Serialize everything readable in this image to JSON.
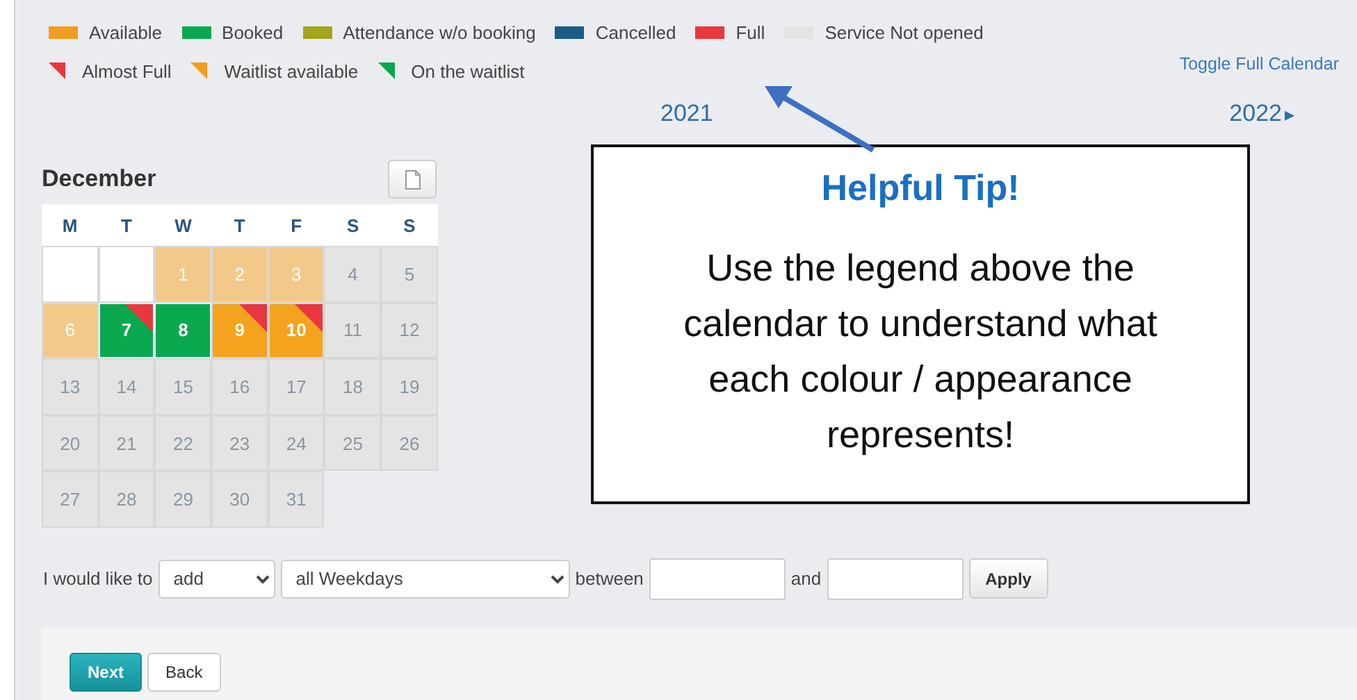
{
  "legend": [
    {
      "label": "Available",
      "kind": "bar",
      "color": "#f39c1f"
    },
    {
      "label": "Booked",
      "kind": "bar",
      "color": "#0aa84f"
    },
    {
      "label": "Attendance w/o booking",
      "kind": "bar",
      "color": "#a3a51c"
    },
    {
      "label": "Cancelled",
      "kind": "bar",
      "color": "#1c5a8a"
    },
    {
      "label": "Full",
      "kind": "bar",
      "color": "#e8373f"
    },
    {
      "label": "Service Not opened",
      "kind": "bar",
      "color": "#e4e4e4"
    },
    {
      "label": "Almost Full",
      "kind": "corner",
      "color": "#e8373f"
    },
    {
      "label": "Waitlist available",
      "kind": "corner",
      "color": "#f39c1f"
    },
    {
      "label": "On the waitlist",
      "kind": "corner",
      "color": "#0aa84f"
    }
  ],
  "toggle_link": "Toggle Full Calendar",
  "years": {
    "current": "2021",
    "next": "2022",
    "next_arrow": "▸"
  },
  "calendar": {
    "month": "December",
    "weekdays": [
      "M",
      "T",
      "W",
      "T",
      "F",
      "S",
      "S"
    ],
    "days": [
      {
        "kind": "blank"
      },
      {
        "kind": "blank"
      },
      {
        "label": "1",
        "kind": "available"
      },
      {
        "label": "2",
        "kind": "available"
      },
      {
        "label": "3",
        "kind": "available"
      },
      {
        "label": "4",
        "kind": "closed"
      },
      {
        "label": "5",
        "kind": "closed"
      },
      {
        "label": "6",
        "kind": "available"
      },
      {
        "label": "7",
        "kind": "booked",
        "color": "#e8373f"
      },
      {
        "label": "8",
        "kind": "booked"
      },
      {
        "label": "9",
        "kind": "waitlist",
        "color": "#e8373f"
      },
      {
        "label": "10",
        "kind": "waitlist",
        "color": "#e8373f"
      },
      {
        "label": "11",
        "kind": "closed"
      },
      {
        "label": "12",
        "kind": "closed"
      },
      {
        "label": "13",
        "kind": "closed"
      },
      {
        "label": "14",
        "kind": "closed"
      },
      {
        "label": "15",
        "kind": "closed"
      },
      {
        "label": "16",
        "kind": "closed"
      },
      {
        "label": "17",
        "kind": "closed"
      },
      {
        "label": "18",
        "kind": "closed"
      },
      {
        "label": "19",
        "kind": "closed"
      },
      {
        "label": "20",
        "kind": "closed"
      },
      {
        "label": "21",
        "kind": "closed"
      },
      {
        "label": "22",
        "kind": "closed"
      },
      {
        "label": "23",
        "kind": "closed"
      },
      {
        "label": "24",
        "kind": "closed"
      },
      {
        "label": "25",
        "kind": "closed"
      },
      {
        "label": "26",
        "kind": "closed"
      },
      {
        "label": "27",
        "kind": "closed"
      },
      {
        "label": "28",
        "kind": "closed"
      },
      {
        "label": "29",
        "kind": "closed"
      },
      {
        "label": "30",
        "kind": "closed"
      },
      {
        "label": "31",
        "kind": "closed"
      }
    ]
  },
  "tip": {
    "title": "Helpful Tip!",
    "text": "Use the legend above the calendar to understand what each colour / appearance represents!"
  },
  "form": {
    "prefix": "I would like to",
    "action": "add",
    "days": "all Weekdays",
    "between": "between",
    "and": "and",
    "apply": "Apply"
  },
  "buttons": {
    "next": "Next",
    "back": "Back"
  }
}
